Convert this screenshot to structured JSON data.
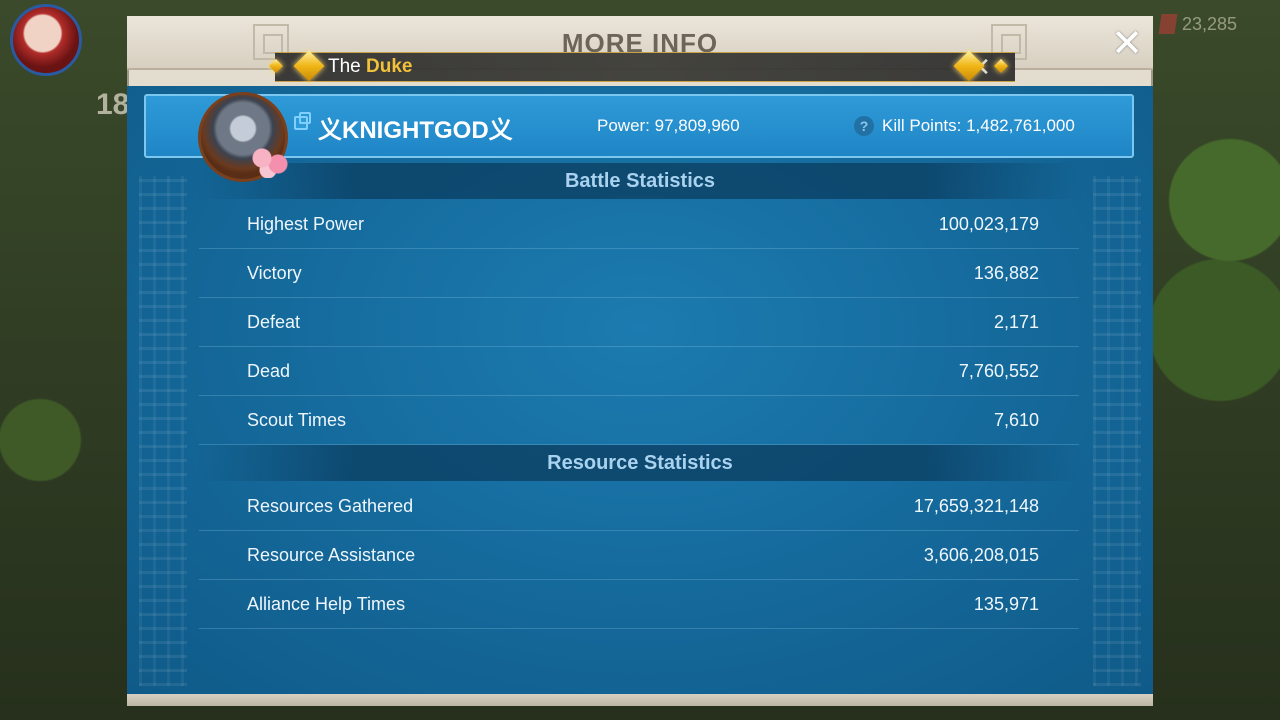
{
  "background": {
    "top_right_counter": "23,285",
    "left_badge": "18"
  },
  "dialog": {
    "header_title": "MORE INFO",
    "close_label": "✕",
    "title_bar": {
      "prefix": "The",
      "rank": "Duke",
      "close_label": "✕"
    },
    "player": {
      "name": "义KNIGHTGOD义",
      "power": "Power: 97,809,960",
      "help_label": "?",
      "kill_points": "Kill Points: 1,482,761,000"
    },
    "battle_statistics": {
      "header": "Battle Statistics",
      "rows": [
        {
          "label": "Highest Power",
          "value": "100,023,179"
        },
        {
          "label": "Victory",
          "value": "136,882"
        },
        {
          "label": "Defeat",
          "value": "2,171"
        },
        {
          "label": "Dead",
          "value": "7,760,552"
        },
        {
          "label": "Scout Times",
          "value": "7,610"
        }
      ]
    },
    "resource_statistics": {
      "header": "Resource Statistics",
      "rows": [
        {
          "label": "Resources Gathered",
          "value": "17,659,321,148"
        },
        {
          "label": "Resource Assistance",
          "value": "3,606,208,015"
        },
        {
          "label": "Alliance Help Times",
          "value": "135,971"
        }
      ]
    }
  },
  "colors": {
    "panel_blue": "#156a9c",
    "banner_blue": "#2f9ad8",
    "rank_gold": "#f2c13a",
    "section_header_text": "#a9d2ee"
  }
}
